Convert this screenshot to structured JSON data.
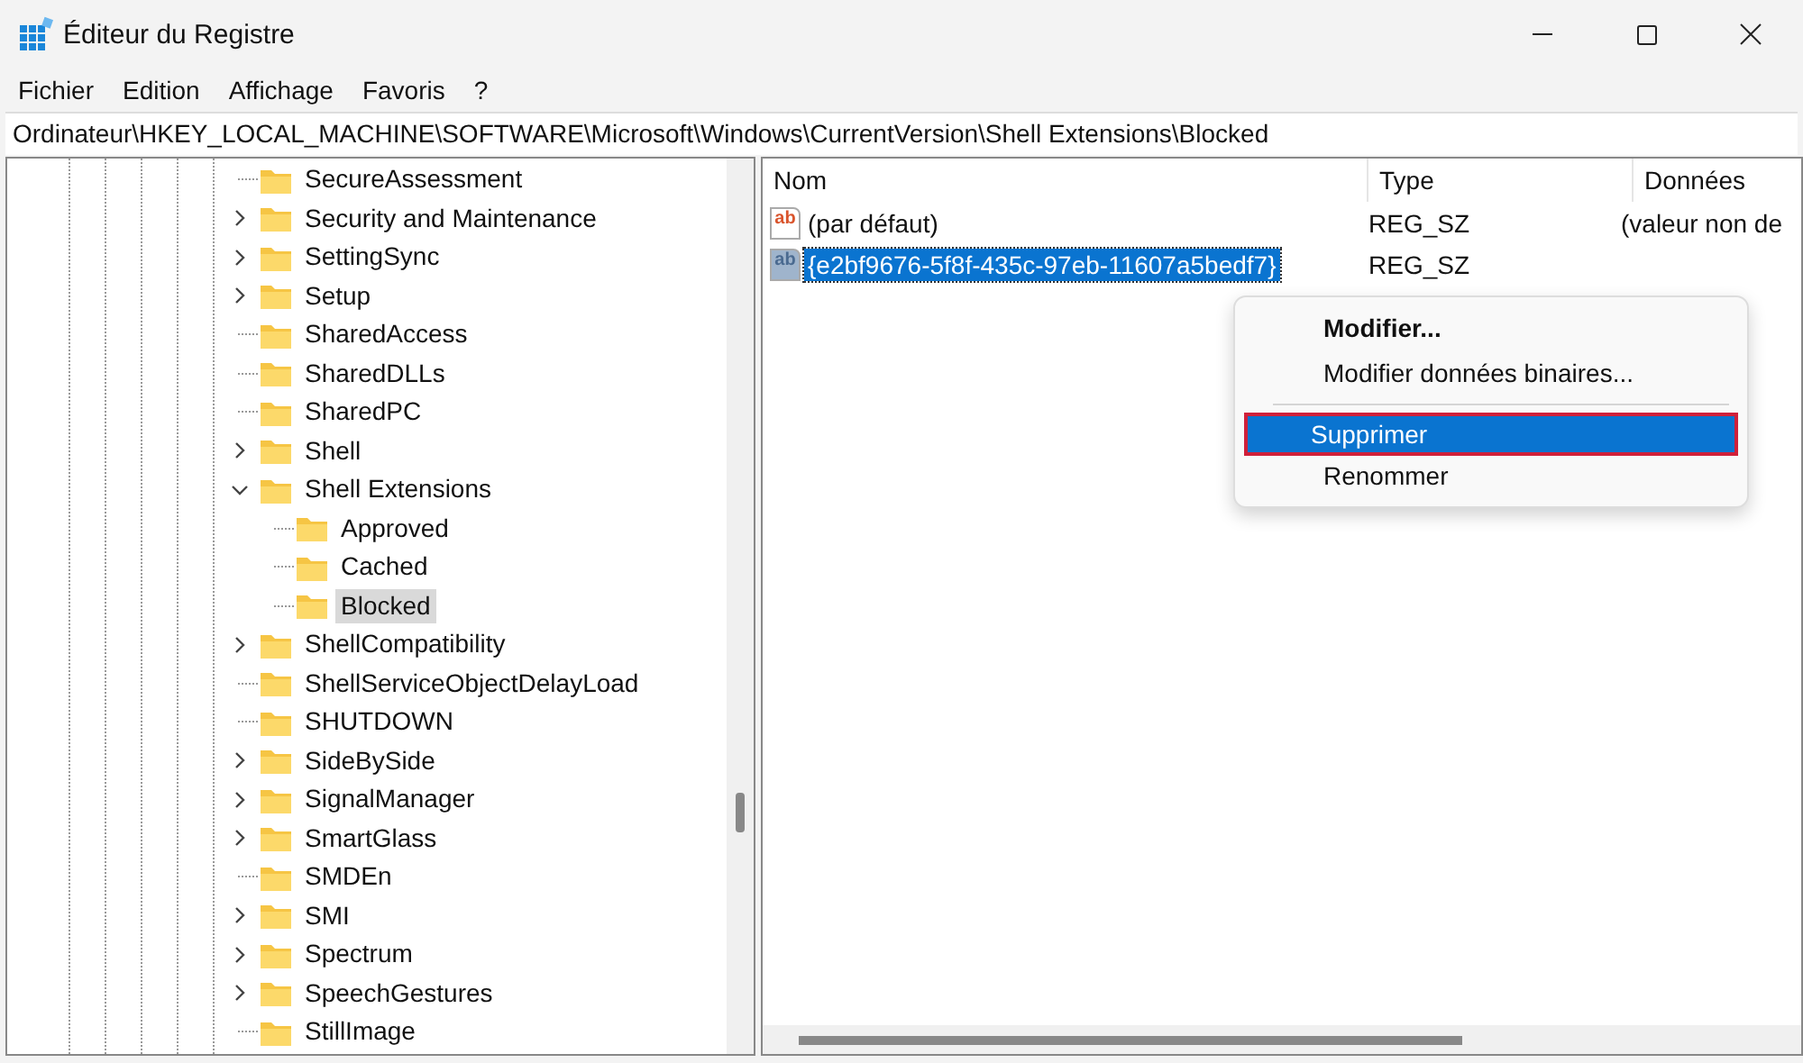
{
  "window": {
    "title": "Éditeur du Registre"
  },
  "menu_bar": [
    "Fichier",
    "Edition",
    "Affichage",
    "Favoris",
    "?"
  ],
  "address_bar": {
    "value": "Ordinateur\\HKEY_LOCAL_MACHINE\\SOFTWARE\\Microsoft\\Windows\\CurrentVersion\\Shell Extensions\\Blocked"
  },
  "tree": {
    "items": [
      {
        "label": "SecureAssessment",
        "kind": "leaf",
        "selected": false
      },
      {
        "label": "Security and Maintenance",
        "kind": "node",
        "expanded": false,
        "selected": false
      },
      {
        "label": "SettingSync",
        "kind": "node",
        "expanded": false,
        "selected": false
      },
      {
        "label": "Setup",
        "kind": "node",
        "expanded": false,
        "selected": false
      },
      {
        "label": "SharedAccess",
        "kind": "leaf",
        "selected": false
      },
      {
        "label": "SharedDLLs",
        "kind": "leaf",
        "selected": false
      },
      {
        "label": "SharedPC",
        "kind": "leaf",
        "selected": false
      },
      {
        "label": "Shell",
        "kind": "node",
        "expanded": false,
        "selected": false
      },
      {
        "label": "Shell Extensions",
        "kind": "node",
        "expanded": true,
        "selected": false,
        "children": [
          {
            "label": "Approved",
            "kind": "leaf",
            "selected": false
          },
          {
            "label": "Cached",
            "kind": "leaf",
            "selected": false
          },
          {
            "label": "Blocked",
            "kind": "leaf",
            "selected": true
          }
        ]
      },
      {
        "label": "ShellCompatibility",
        "kind": "node",
        "expanded": false,
        "selected": false
      },
      {
        "label": "ShellServiceObjectDelayLoad",
        "kind": "leaf",
        "selected": false
      },
      {
        "label": "SHUTDOWN",
        "kind": "leaf",
        "selected": false
      },
      {
        "label": "SideBySide",
        "kind": "node",
        "expanded": false,
        "selected": false
      },
      {
        "label": "SignalManager",
        "kind": "node",
        "expanded": false,
        "selected": false
      },
      {
        "label": "SmartGlass",
        "kind": "node",
        "expanded": false,
        "selected": false
      },
      {
        "label": "SMDEn",
        "kind": "leaf",
        "selected": false
      },
      {
        "label": "SMI",
        "kind": "node",
        "expanded": false,
        "selected": false
      },
      {
        "label": "Spectrum",
        "kind": "node",
        "expanded": false,
        "selected": false
      },
      {
        "label": "SpeechGestures",
        "kind": "node",
        "expanded": false,
        "selected": false
      },
      {
        "label": "StillImage",
        "kind": "leaf",
        "selected": false
      }
    ]
  },
  "values_table": {
    "columns": [
      "Nom",
      "Type",
      "Données"
    ],
    "rows": [
      {
        "icon_text": "ab",
        "name": "(par défaut)",
        "type": "REG_SZ",
        "data": "(valeur non de",
        "selected": false
      },
      {
        "icon_text": "ab",
        "name": "{e2bf9676-5f8f-435c-97eb-11607a5bedf7}",
        "type": "REG_SZ",
        "selected": true
      }
    ]
  },
  "context_menu": {
    "items": [
      {
        "kind": "item",
        "label": "Modifier...",
        "default": true,
        "selected": false
      },
      {
        "kind": "item",
        "label": "Modifier données binaires...",
        "default": false,
        "selected": false
      },
      {
        "kind": "separator"
      },
      {
        "kind": "item",
        "label": "Supprimer",
        "default": false,
        "selected": true
      },
      {
        "kind": "item",
        "label": "Renommer",
        "default": false,
        "selected": false
      }
    ]
  }
}
